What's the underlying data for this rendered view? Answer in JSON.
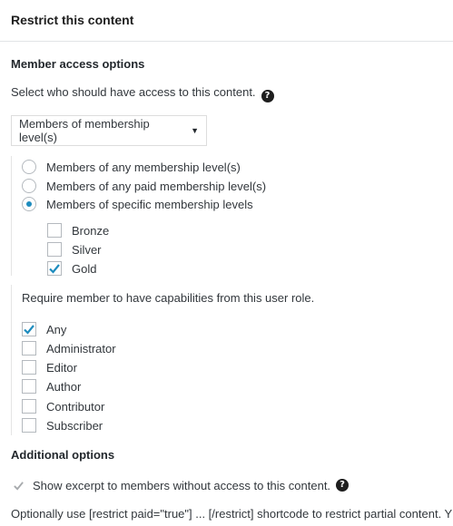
{
  "header": {
    "title": "Restrict this content"
  },
  "member_access": {
    "title": "Member access options",
    "description": "Select who should have access to this content.",
    "help_icon": "?",
    "select": {
      "value": "Members of membership level(s)",
      "caret": "▼"
    },
    "radios": [
      {
        "label": "Members of any membership level(s)",
        "selected": false
      },
      {
        "label": "Members of any paid membership level(s)",
        "selected": false
      },
      {
        "label": "Members of specific membership levels",
        "selected": true
      }
    ],
    "levels": [
      {
        "label": "Bronze",
        "checked": false
      },
      {
        "label": "Silver",
        "checked": false
      },
      {
        "label": "Gold",
        "checked": true
      }
    ]
  },
  "capabilities": {
    "description": "Require member to have capabilities from this user role.",
    "roles": [
      {
        "label": "Any",
        "checked": true
      },
      {
        "label": "Administrator",
        "checked": false
      },
      {
        "label": "Editor",
        "checked": false
      },
      {
        "label": "Author",
        "checked": false
      },
      {
        "label": "Contributor",
        "checked": false
      },
      {
        "label": "Subscriber",
        "checked": false
      }
    ]
  },
  "additional": {
    "title": "Additional options",
    "excerpt_label": "Show excerpt to members without access to this content.",
    "excerpt_checked": true,
    "help_icon": "?",
    "shortcode_note": "Optionally use [restrict paid=\"true\"] ... [/restrict] shortcode to restrict partial content. Y"
  },
  "colors": {
    "check": "#1e8cbe",
    "radio_dot": "#1e8cbe",
    "excerpt_check": "#a7aaad"
  }
}
